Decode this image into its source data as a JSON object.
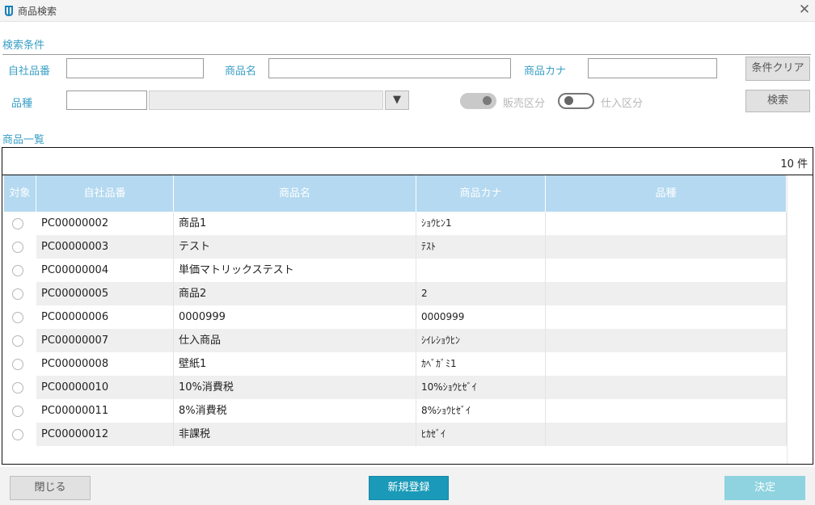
{
  "window": {
    "title": "商品検索",
    "app_icon": "app-logo-icon",
    "close_icon": "close-icon"
  },
  "search": {
    "section_title": "検索条件",
    "labels": {
      "code": "自社品番",
      "name": "商品名",
      "kana": "商品カナ",
      "type": "品種"
    },
    "values": {
      "code": "",
      "name": "",
      "kana": "",
      "type_code": "",
      "type_select": ""
    },
    "toggles": [
      {
        "label": "販売区分",
        "state": "on",
        "enabled": false
      },
      {
        "label": "仕入区分",
        "state": "off",
        "enabled": true
      }
    ],
    "clear_button": "条件クリア",
    "search_button": "検索",
    "dropdown_icon": "triangle-down-icon"
  },
  "list": {
    "section_title": "商品一覧",
    "count_text": "10 件",
    "columns": [
      "対象",
      "自社品番",
      "商品名",
      "商品カナ",
      "品種"
    ],
    "rows": [
      {
        "code": "PC00000002",
        "name": "商品1",
        "kana": "ｼｮｳﾋﾝ1",
        "type": ""
      },
      {
        "code": "PC00000003",
        "name": "テスト",
        "kana": "ﾃｽﾄ",
        "type": ""
      },
      {
        "code": "PC00000004",
        "name": "単価マトリックステスト",
        "kana": "",
        "type": ""
      },
      {
        "code": "PC00000005",
        "name": "商品2",
        "kana": "2",
        "type": ""
      },
      {
        "code": "PC00000006",
        "name": "0000999",
        "kana": "0000999",
        "type": ""
      },
      {
        "code": "PC00000007",
        "name": "仕入商品",
        "kana": "ｼｲﾚｼｮｳﾋﾝ",
        "type": ""
      },
      {
        "code": "PC00000008",
        "name": "壁紙1",
        "kana": "ｶﾍﾞｶﾞﾐ1",
        "type": ""
      },
      {
        "code": "PC00000010",
        "name": "10%消費税",
        "kana": "10%ｼｮｳﾋｾﾞｲ",
        "type": ""
      },
      {
        "code": "PC00000011",
        "name": "8%消費税",
        "kana": "8%ｼｮｳﾋｾﾞｲ",
        "type": ""
      },
      {
        "code": "PC00000012",
        "name": "非課税",
        "kana": "ﾋｶｾﾞｲ",
        "type": ""
      }
    ]
  },
  "footer": {
    "close_button": "閉じる",
    "new_button": "新規登録",
    "decide_button": "決定"
  },
  "colors": {
    "accent": "#3a9fc5",
    "header_bg": "#b4d9f0",
    "primary_button": "#1a9ab8",
    "decide_button_disabled": "#8fd3e0"
  }
}
